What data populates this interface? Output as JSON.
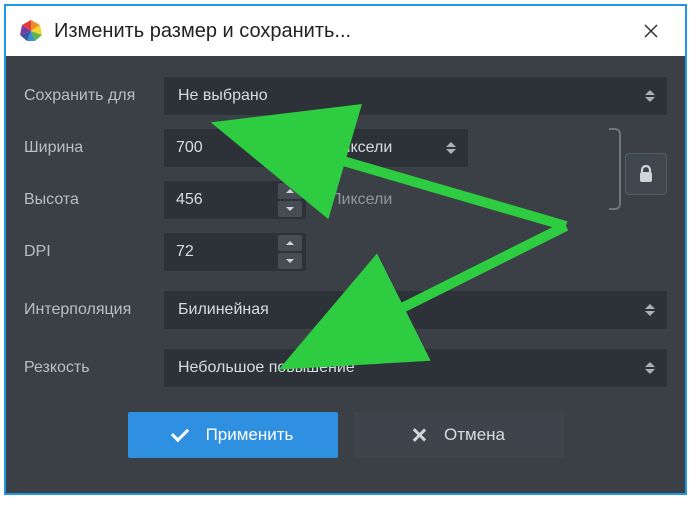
{
  "window": {
    "title": "Изменить размер и сохранить..."
  },
  "labels": {
    "saveFor": "Сохранить для",
    "width": "Ширина",
    "height": "Высота",
    "dpi": "DPI",
    "interpolation": "Интерполяция",
    "sharpness": "Резкость"
  },
  "values": {
    "saveFor": "Не выбрано",
    "width": "700",
    "height": "456",
    "dpi": "72",
    "widthUnit": "Пиксели",
    "heightUnit": "Пиксели",
    "interpolation": "Билинейная",
    "sharpness": "Небольшое повышение"
  },
  "buttons": {
    "apply": "Применить",
    "cancel": "Отмена"
  }
}
